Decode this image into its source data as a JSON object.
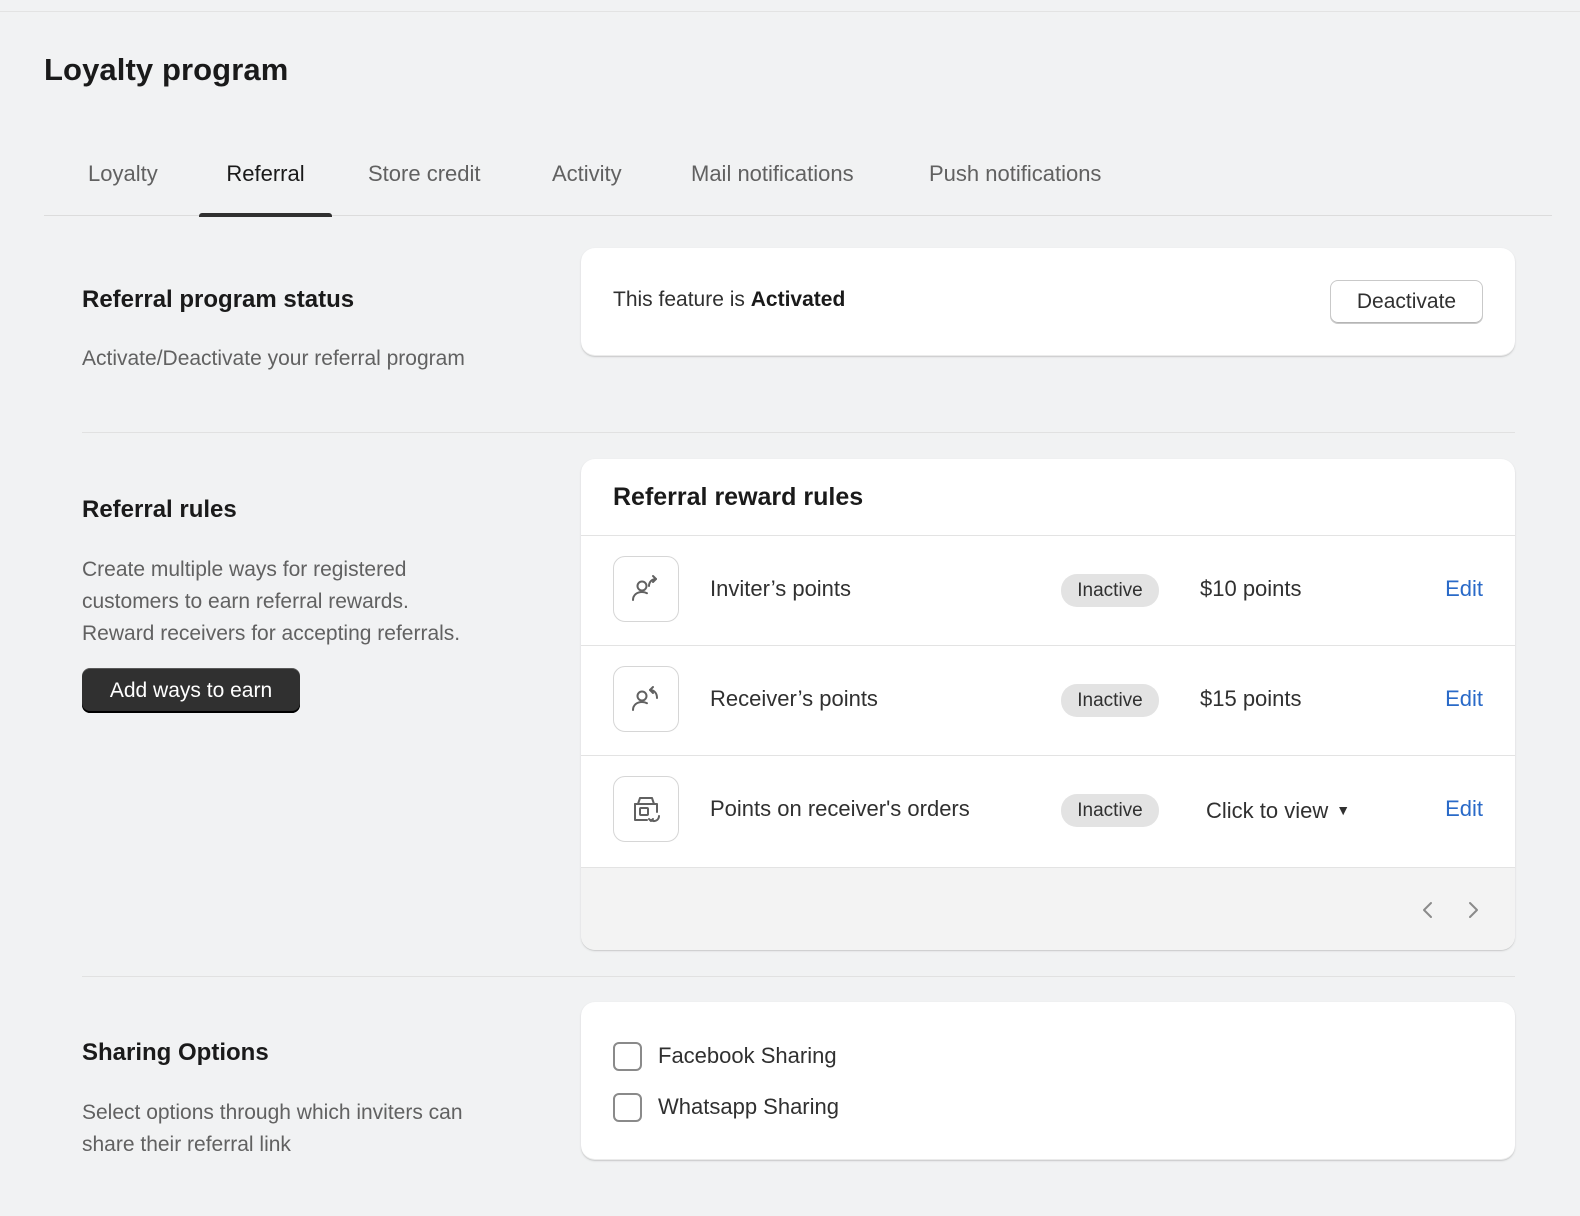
{
  "page": {
    "title": "Loyalty program"
  },
  "tabs": [
    {
      "label": "Loyalty"
    },
    {
      "label": "Referral",
      "active": true
    },
    {
      "label": "Store credit"
    },
    {
      "label": "Activity"
    },
    {
      "label": "Mail notifications"
    },
    {
      "label": "Push notifications"
    }
  ],
  "status_section": {
    "title": "Referral program status",
    "description": "Activate/Deactivate your referral program",
    "status_prefix": "This feature is",
    "status_value": "Activated",
    "deactivate_label": "Deactivate"
  },
  "rules_section": {
    "title": "Referral rules",
    "description_lines": [
      "Create multiple ways for registered",
      "customers to earn referral rewards.",
      "Reward receivers for accepting referrals."
    ],
    "add_button_label": "Add ways to earn",
    "card_title": "Referral reward rules",
    "rules": [
      {
        "icon": "person-arrow-right-icon",
        "name": "Inviter’s points",
        "status": "Inactive",
        "value": "$10 points",
        "edit_label": "Edit"
      },
      {
        "icon": "person-arrow-left-icon",
        "name": "Receiver’s points",
        "status": "Inactive",
        "value": "$15 points",
        "edit_label": "Edit"
      },
      {
        "icon": "order-return-icon",
        "name": "Points on receiver's orders",
        "status": "Inactive",
        "value": "Click to view",
        "edit_label": "Edit"
      }
    ]
  },
  "sharing_section": {
    "title": "Sharing Options",
    "description_lines": [
      "Select options through which inviters can",
      "share their referral link"
    ],
    "options": [
      {
        "label": "Facebook Sharing",
        "checked": false
      },
      {
        "label": "Whatsapp Sharing",
        "checked": false
      }
    ]
  },
  "colors": {
    "accent_link": "#2a6ac8",
    "primary_button": "#303030",
    "badge_bg": "#e3e3e3"
  }
}
